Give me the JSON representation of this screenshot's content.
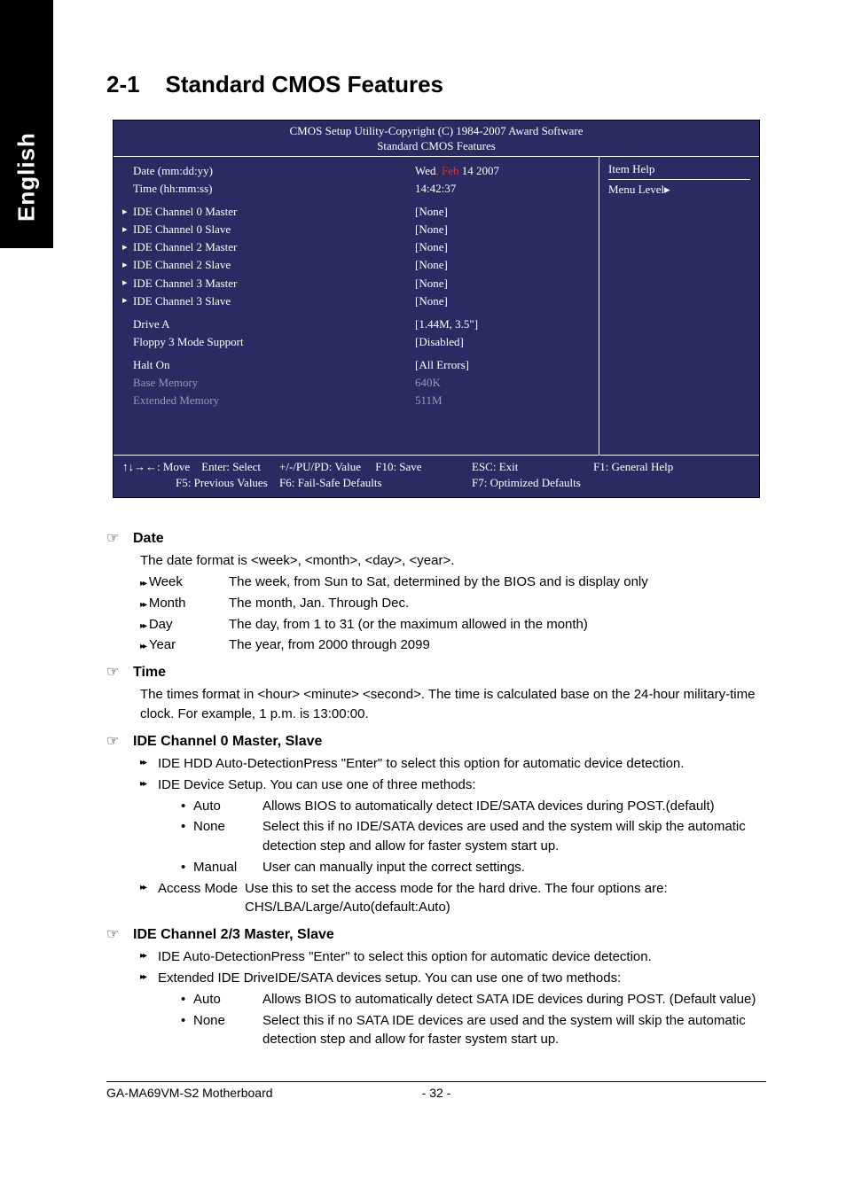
{
  "side_tab": "English",
  "section": {
    "number": "2-1",
    "title": "Standard CMOS Features"
  },
  "bios": {
    "header1": "CMOS Setup Utility-Copyright (C) 1984-2007 Award Software",
    "header2": "Standard CMOS Features",
    "help_title": "Item Help",
    "menu_level": "Menu Level",
    "rows": [
      {
        "indent": false,
        "label": "Date (mm:dd:yy)",
        "value_prefix": "Wed",
        "value_red": ", Feb",
        "value_suffix": "  14  2007"
      },
      {
        "indent": false,
        "label": "Time (hh:mm:ss)",
        "value": "14:42:37"
      }
    ],
    "ide_rows": [
      {
        "label": "IDE Channel 0 Master",
        "value": "[None]"
      },
      {
        "label": "IDE Channel 0 Slave",
        "value": "[None]"
      },
      {
        "label": "IDE Channel 2 Master",
        "value": "[None]"
      },
      {
        "label": "IDE Channel 2 Slave",
        "value": "[None]"
      },
      {
        "label": "IDE Channel 3 Master",
        "value": "[None]"
      },
      {
        "label": "IDE Channel 3 Slave",
        "value": "[None]"
      }
    ],
    "drive_rows": [
      {
        "label": "Drive A",
        "value": "[1.44M, 3.5\"]"
      },
      {
        "label": "Floppy 3 Mode Support",
        "value": "[Disabled]"
      }
    ],
    "halt_rows": [
      {
        "label": "Halt On",
        "value": "[All Errors]",
        "dim": false
      },
      {
        "label": "Base Memory",
        "value": "640K",
        "dim": true
      },
      {
        "label": "Extended Memory",
        "value": "511M",
        "dim": true
      }
    ],
    "footer": {
      "c1a": "↑↓→←: Move",
      "c1b": "Enter: Select",
      "c2a": "+/-/PU/PD: Value",
      "c2b": "F10: Save",
      "c3a": "ESC: Exit",
      "c3b": "F1: General Help",
      "r2a": "F5: Previous Values",
      "r2b": "F6: Fail-Safe Defaults",
      "r2c": "F7: Optimized Defaults"
    }
  },
  "body": {
    "date": {
      "title": "Date",
      "intro": "The date format is <week>, <month>, <day>, <year>.",
      "items": [
        {
          "term": "Week",
          "desc": "The week, from Sun to Sat, determined by the BIOS and is display only"
        },
        {
          "term": "Month",
          "desc": "The month, Jan. Through Dec."
        },
        {
          "term": "Day",
          "desc": "The day, from 1 to 31 (or the maximum allowed in the month)"
        },
        {
          "term": "Year",
          "desc": "The year, from 2000 through 2099"
        }
      ]
    },
    "time": {
      "title": "Time",
      "para": "The times format in <hour> <minute> <second>. The time is calculated base on the 24-hour military-time clock. For example, 1 p.m. is 13:00:00."
    },
    "ide0": {
      "title": "IDE Channel 0 Master, Slave",
      "l1_lead": "IDE HDD Auto-Detection",
      "l1_rest": " Press \"Enter\" to select this option for automatic device detection.",
      "l2": "IDE Device Setup.  You can use one of three methods:",
      "bullets": [
        {
          "term": "Auto",
          "desc": "Allows BIOS to automatically detect IDE/SATA devices during POST.(default)"
        },
        {
          "term": "None",
          "desc": "Select this if no IDE/SATA devices are used and the system will skip the automatic detection step and allow for faster system start up."
        },
        {
          "term": "Manual",
          "desc": "User can manually input the correct settings."
        }
      ],
      "access_term": "Access Mode",
      "access_desc": "Use this to set the access mode for the hard drive. The four options are: CHS/LBA/Large/Auto(default:Auto)"
    },
    "ide23": {
      "title": "IDE Channel 2/3 Master, Slave",
      "l1_lead": "IDE Auto-Detection",
      "l1_rest": "  Press \"Enter\" to select this option for automatic device detection.",
      "l2_lead": "Extended IDE Drive",
      "l2_rest": " IDE/SATA devices setup. You can use one of two methods:",
      "bullets": [
        {
          "term": "Auto",
          "desc": "Allows BIOS to automatically detect SATA IDE devices during POST. (Default value)"
        },
        {
          "term": "None",
          "desc": "Select this if no SATA IDE devices are used and the system will skip the automatic detection step and allow for faster system start up."
        }
      ]
    }
  },
  "footer": {
    "left": "GA-MA69VM-S2 Motherboard",
    "center": "- 32 -"
  }
}
